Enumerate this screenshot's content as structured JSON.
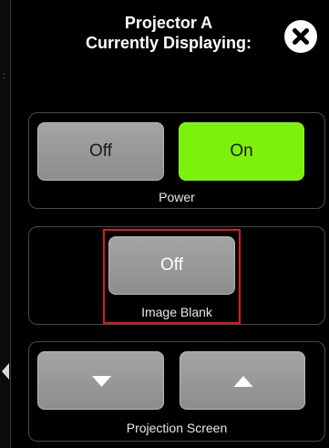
{
  "dialog": {
    "title_line1": "Projector A",
    "title_line2": "Currently Displaying:",
    "close_icon": "close-icon"
  },
  "power": {
    "label": "Power",
    "off_label": "Off",
    "on_label": "On",
    "state": "On",
    "active_color": "#7EF00E"
  },
  "image_blank": {
    "label": "Image Blank",
    "button_label": "Off",
    "highlight_color": "#E01818"
  },
  "projection_screen": {
    "label": "Projection Screen",
    "down_icon": "triangle-down-icon",
    "up_icon": "triangle-up-icon"
  }
}
